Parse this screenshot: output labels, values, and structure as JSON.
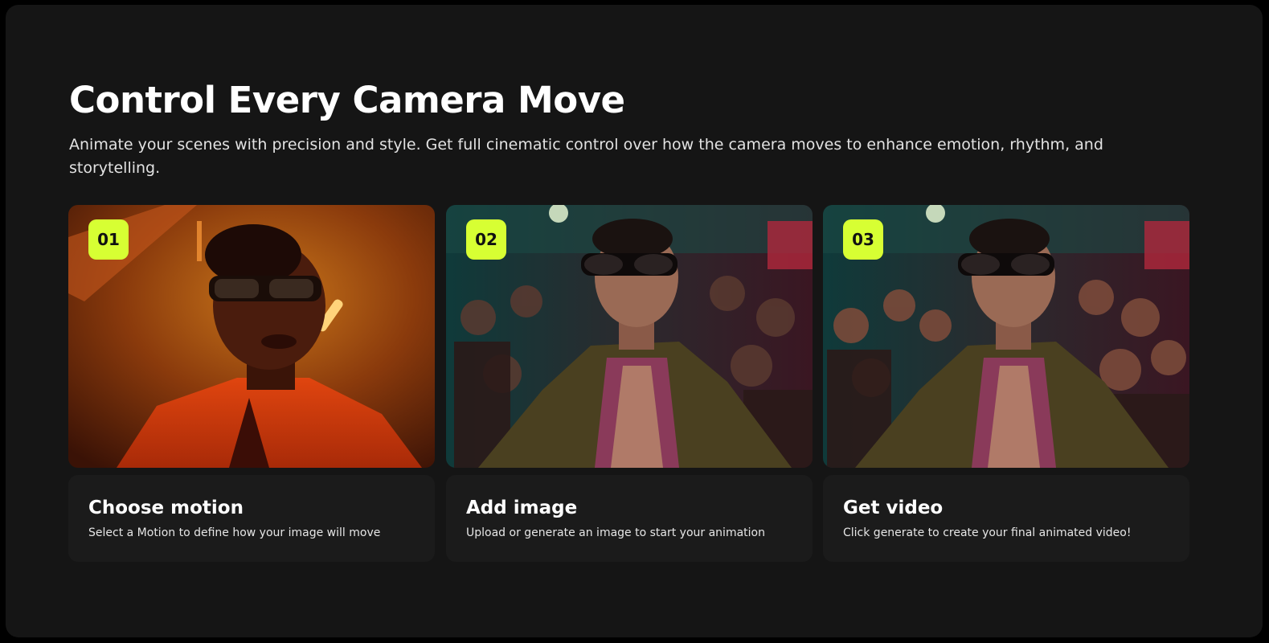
{
  "section": {
    "heading": "Control Every Camera Move",
    "subheading": "Animate your scenes with precision and style. Get full cinematic control over how the camera moves to enhance emotion, rhythm, and storytelling."
  },
  "steps": [
    {
      "number": "01",
      "title": "Choose motion",
      "description": "Select a Motion to define how your image will move",
      "image": "man-in-sunglasses-orange-light-photo"
    },
    {
      "number": "02",
      "title": "Add image",
      "description": "Upload or generate an image to start your animation",
      "image": "man-dancing-in-crowd-photo"
    },
    {
      "number": "03",
      "title": "Get video",
      "description": "Click generate to create your final animated video!",
      "image": "man-dancing-in-crowd-video-frame"
    }
  ],
  "colors": {
    "background": "#151515",
    "card": "#1b1b1b",
    "accent": "#d7ff33",
    "text": "#ffffff"
  }
}
